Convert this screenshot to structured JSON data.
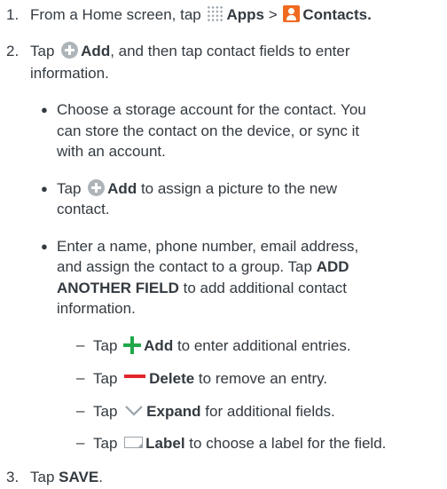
{
  "steps": [
    {
      "number": "1.",
      "text_a": "From a Home screen, tap",
      "apps_label": "Apps",
      "separator": ">",
      "contacts_label": "Contacts",
      "end": "."
    },
    {
      "number": "2.",
      "text_a": "Tap",
      "add_label": "Add",
      "text_b": ", and then tap contact fields to enter",
      "text_c": "information."
    },
    {
      "number": "3.",
      "text_a": "Tap",
      "save_label": "SAVE",
      "end": "."
    }
  ],
  "bullets": [
    {
      "symbol": "●",
      "lines": [
        "Choose a storage account for the contact. You",
        "can store the contact on the device, or sync it",
        "with an account."
      ]
    },
    {
      "symbol": "●",
      "tap": "Tap",
      "add_label": "Add",
      "text_a": "to assign a picture to the new",
      "text_b": "contact."
    },
    {
      "symbol": "●",
      "line1": "Enter a name, phone number, email address,",
      "line2_a": "and assign the contact to a group. Tap",
      "line2_b": "ADD",
      "line3_a": "ANOTHER FIELD",
      "line3_b": "to add additional contact",
      "line4": "information."
    }
  ],
  "subitems": [
    {
      "dash": "–",
      "tap": "Tap",
      "label": "Add",
      "text": "to enter additional entries.",
      "icon": "plus-icon",
      "icon_color": "#20a84a"
    },
    {
      "dash": "–",
      "tap": "Tap",
      "label": "Delete",
      "text": "to remove an entry.",
      "icon": "minus-icon",
      "icon_color": "#e4252b"
    },
    {
      "dash": "–",
      "tap": "Tap",
      "label": "Expand",
      "text": "for additional fields.",
      "icon": "chevron-down-icon",
      "icon_color": "#9aa3aa"
    },
    {
      "dash": "–",
      "tap": "Tap",
      "label": "Label",
      "text": "to choose a label for the field.",
      "icon": "label-icon",
      "icon_color": "#9aa3aa"
    }
  ],
  "icons": {
    "apps": "apps-grid-icon",
    "contacts": "contacts-icon",
    "add": "add-circle-icon",
    "contacts_color": "#f06a21",
    "text_color": "#333a40"
  }
}
